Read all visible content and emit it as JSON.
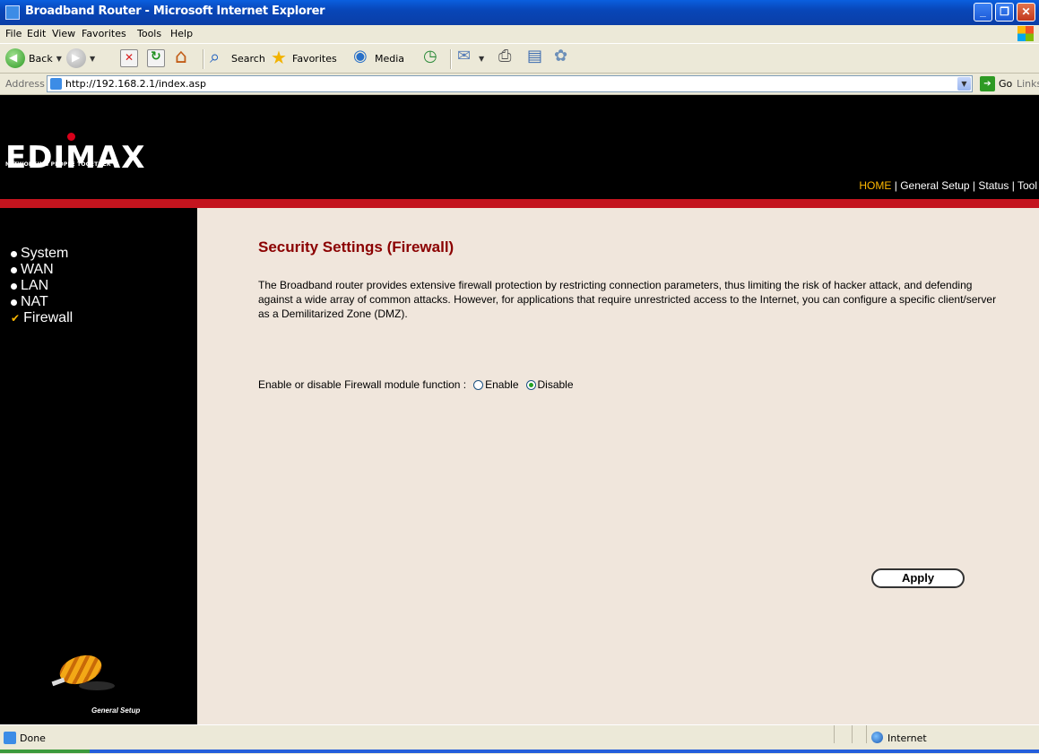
{
  "window": {
    "title": "Broadband Router - Microsoft Internet Explorer"
  },
  "menubar": {
    "items": [
      "File",
      "Edit",
      "View",
      "Favorites",
      "Tools",
      "Help"
    ]
  },
  "toolbar": {
    "back_label": "Back",
    "search_label": "Search",
    "favorites_label": "Favorites",
    "media_label": "Media"
  },
  "address": {
    "label": "Address",
    "url": "http://192.168.2.1/index.asp",
    "go_label": "Go",
    "links_label": "Links"
  },
  "header": {
    "logo": "EDIMAX",
    "tagline": "NETWORKING PEOPLE TOGETHER",
    "nav": [
      "HOME",
      "General Setup",
      "Status",
      "Tool"
    ]
  },
  "sidebar": {
    "items": [
      "System",
      "WAN",
      "LAN",
      "NAT",
      "Firewall"
    ],
    "caption": "General Setup"
  },
  "main": {
    "title": "Security Settings (Firewall)",
    "description": "The Broadband router provides extensive firewall protection by restricting connection parameters, thus limiting the risk of hacker attack, and defending against a wide array of common attacks. However, for applications that require unrestricted access to the Internet, you can configure a specific client/server as a Demilitarized Zone (DMZ).",
    "firewall_label": "Enable or disable Firewall module function :",
    "enable_label": "Enable",
    "disable_label": "Disable",
    "selected": "Disable",
    "apply_label": "Apply"
  },
  "status": {
    "text": "Done",
    "zone": "Internet"
  },
  "colors": {
    "title_red": "#8b0000",
    "accent_red": "#c4141e",
    "nav_orange": "#ffb800",
    "content_bg": "#f0e6dc"
  }
}
